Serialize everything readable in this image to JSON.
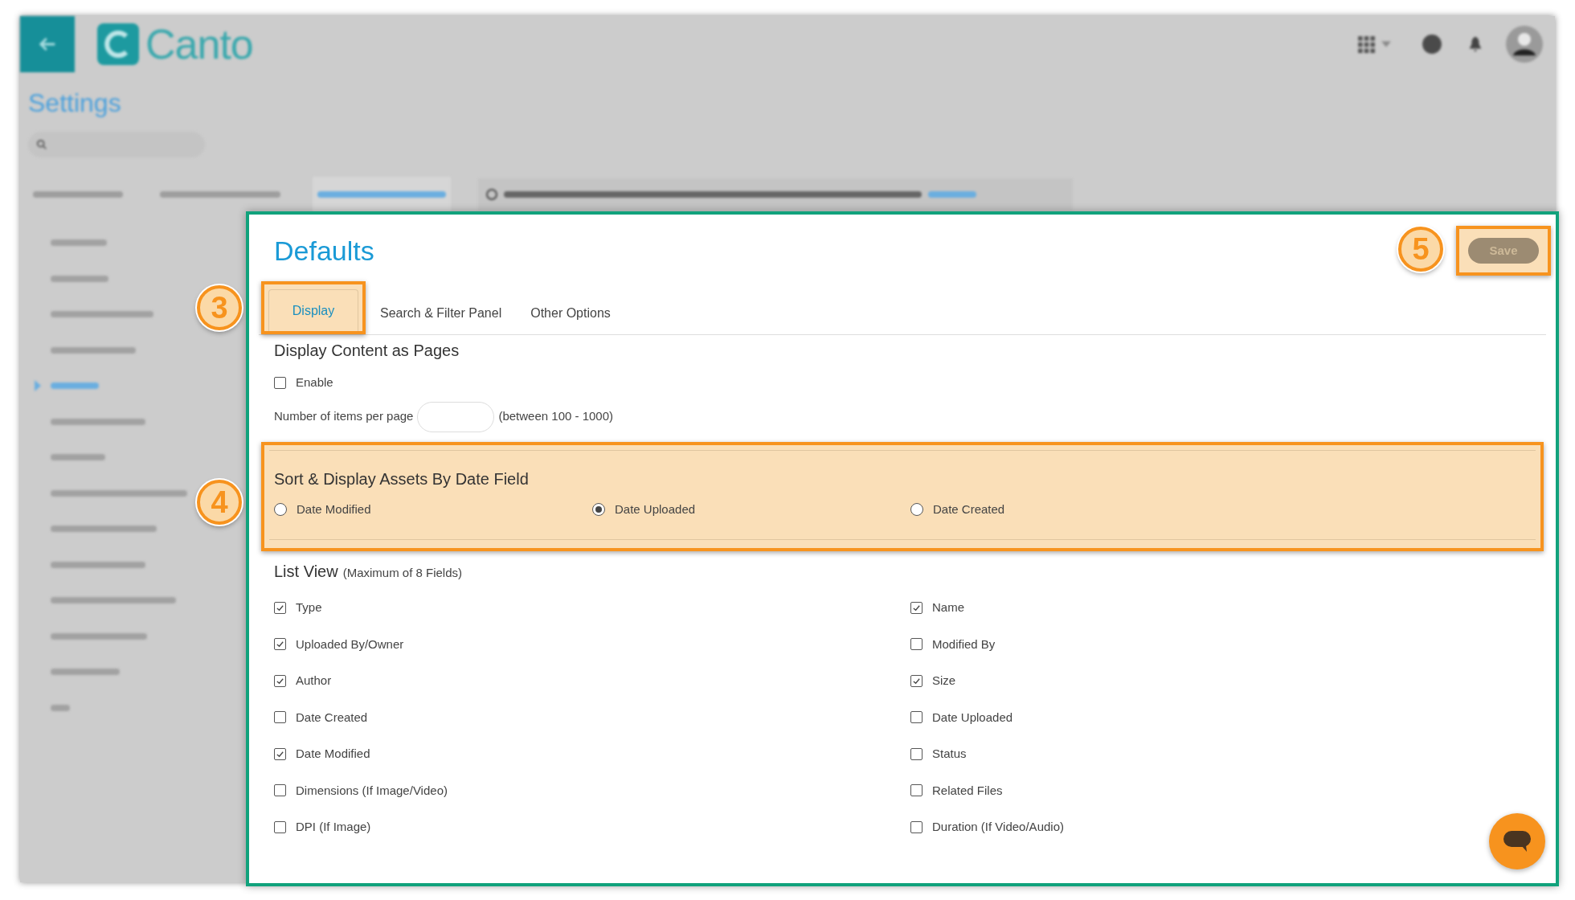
{
  "app": {
    "logo": "Canto",
    "page_title": "Settings",
    "nav_tabs": [
      {
        "selected": false
      },
      {
        "selected": false
      },
      {
        "selected": true
      }
    ],
    "sidebar": {
      "items": [
        {
          "selected": false
        },
        {
          "selected": false
        },
        {
          "selected": false
        },
        {
          "selected": false
        },
        {
          "selected": true
        },
        {
          "selected": false
        },
        {
          "selected": false
        },
        {
          "selected": false
        },
        {
          "selected": false
        },
        {
          "selected": false
        },
        {
          "selected": false
        },
        {
          "selected": false
        },
        {
          "selected": false
        },
        {
          "selected": false
        }
      ]
    }
  },
  "panel": {
    "title": "Defaults",
    "save_button": {
      "label": "Save",
      "disabled": true
    },
    "tabs": [
      {
        "label": "Display",
        "selected": true
      },
      {
        "label": "Search & Filter Panel",
        "selected": false
      },
      {
        "label": "Other Options",
        "selected": false
      }
    ],
    "pages_section": {
      "title": "Display Content as Pages",
      "enable": {
        "label": "Enable",
        "checked": false
      },
      "items_per_page": {
        "label": "Number of items per page",
        "hint": "(between 100 - 1000)"
      }
    },
    "sort_section": {
      "title": "Sort & Display Assets By Date Field",
      "options": [
        {
          "label": "Date Modified",
          "selected": false
        },
        {
          "label": "Date Uploaded",
          "selected": true
        },
        {
          "label": "Date Created",
          "selected": false
        }
      ]
    },
    "list_view": {
      "title": "List View",
      "note": "(Maximum of 8 Fields)",
      "fields": [
        {
          "label": "Type",
          "checked": true
        },
        {
          "label": "Name",
          "checked": true
        },
        {
          "label": "Uploaded By/Owner",
          "checked": true
        },
        {
          "label": "Modified By",
          "checked": false
        },
        {
          "label": "Author",
          "checked": true
        },
        {
          "label": "Size",
          "checked": true
        },
        {
          "label": "Date Created",
          "checked": false
        },
        {
          "label": "Date Uploaded",
          "checked": false
        },
        {
          "label": "Date Modified",
          "checked": true
        },
        {
          "label": "Status",
          "checked": false
        },
        {
          "label": "Dimensions (If Image/Video)",
          "checked": false
        },
        {
          "label": "Related Files",
          "checked": false
        },
        {
          "label": "DPI (If Image)",
          "checked": false
        },
        {
          "label": "Duration (If Video/Audio)",
          "checked": false
        }
      ]
    }
  },
  "annotations": [
    {
      "label": "3"
    },
    {
      "label": "4"
    },
    {
      "label": "5"
    }
  ]
}
